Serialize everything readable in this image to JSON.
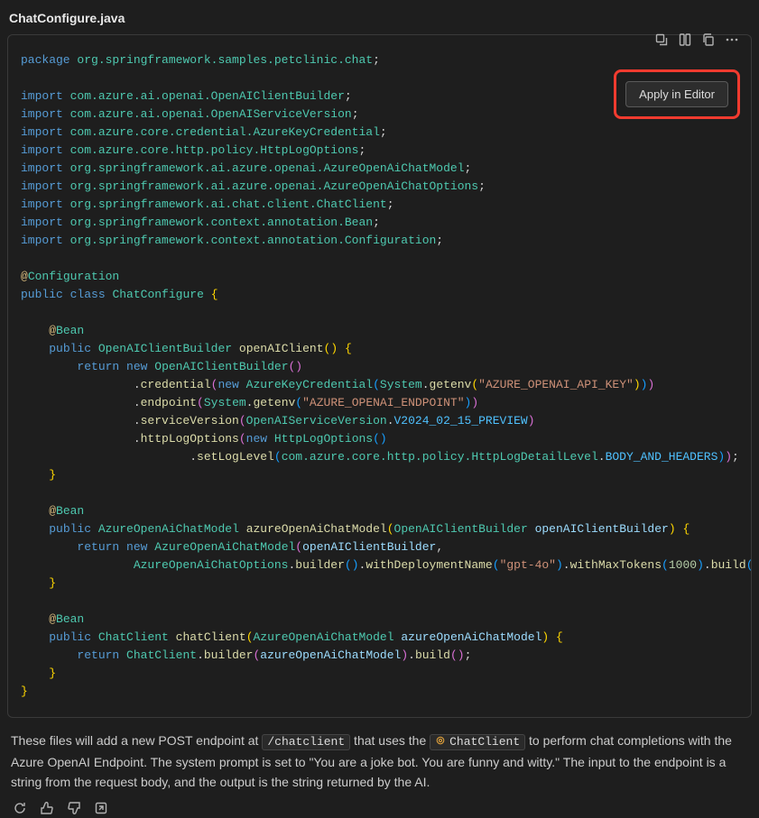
{
  "filename": "ChatConfigure.java",
  "apply_button": "Apply in Editor",
  "toolbar_icons": {
    "insert": "insert-at-cursor-icon",
    "new_file": "insert-new-file-icon",
    "copy": "copy-icon",
    "more": "more-icon"
  },
  "code": {
    "pkg_kw": "package",
    "pkg_path": "org.springframework.samples.petclinic.chat",
    "import_kw": "import",
    "imports": [
      "com.azure.ai.openai.OpenAIClientBuilder",
      "com.azure.ai.openai.OpenAIServiceVersion",
      "com.azure.core.credential.AzureKeyCredential",
      "com.azure.core.http.policy.HttpLogOptions",
      "org.springframework.ai.azure.openai.AzureOpenAiChatModel",
      "org.springframework.ai.azure.openai.AzureOpenAiChatOptions",
      "org.springframework.ai.chat.client.ChatClient",
      "org.springframework.context.annotation.Bean",
      "org.springframework.context.annotation.Configuration"
    ],
    "ann_config": "Configuration",
    "ann_bean": "Bean",
    "public_kw": "public",
    "class_kw": "class",
    "return_kw": "return",
    "new_kw": "new",
    "class_name": "ChatConfigure",
    "m1_type": "OpenAIClientBuilder",
    "m1_name": "openAIClient",
    "m1_new_type": "OpenAIClientBuilder",
    "m1_cred": "credential",
    "m1_cred_type": "AzureKeyCredential",
    "m1_sys": "System",
    "m1_getenv": "getenv",
    "m1_env_key": "\"AZURE_OPENAI_API_KEY\"",
    "m1_endpoint": "endpoint",
    "m1_env_ep": "\"AZURE_OPENAI_ENDPOINT\"",
    "m1_sv": "serviceVersion",
    "m1_sv_type": "OpenAIServiceVersion",
    "m1_sv_val": "V2024_02_15_PREVIEW",
    "m1_hlo": "httpLogOptions",
    "m1_hlo_type": "HttpLogOptions",
    "m1_set": "setLogLevel",
    "m1_set_path": "com.azure.core.http.policy.HttpLogDetailLevel",
    "m1_set_val": "BODY_AND_HEADERS",
    "m2_type": "AzureOpenAiChatModel",
    "m2_name": "azureOpenAiChatModel",
    "m2_param_type": "OpenAIClientBuilder",
    "m2_param_name": "openAIClientBuilder",
    "m2_opt_type": "AzureOpenAiChatOptions",
    "m2_builder": "builder",
    "m2_with_dep": "withDeploymentName",
    "m2_dep_val": "\"gpt-4o\"",
    "m2_with_tok": "withMaxTokens",
    "m2_tok_val": "1000",
    "m2_build": "build",
    "m3_type": "ChatClient",
    "m3_name": "chatClient",
    "m3_param_type": "AzureOpenAiChatModel",
    "m3_param_name": "azureOpenAiChatModel"
  },
  "explain": {
    "p1": "These files will add a new POST endpoint at ",
    "chip1": "/chatclient",
    "p2": " that uses the ",
    "chip2": "ChatClient",
    "p3": " to perform chat completions with the Azure OpenAI Endpoint. The system prompt is set to \"You are a joke bot. You are funny and witty.\" The input to the endpoint is a string from the request body, and the output is the string returned by the AI."
  },
  "action_icons": {
    "retry": "retry-icon",
    "up": "thumbs-up-icon",
    "down": "thumbs-down-icon",
    "edit": "edit-ext-icon"
  }
}
